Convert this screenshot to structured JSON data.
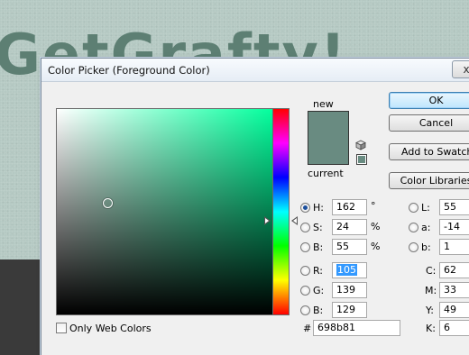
{
  "background": {
    "headline_text": "GetGrafty!",
    "colors": {
      "canvas": "#b5c9c3",
      "headline": "#5d7f73",
      "lower_band": "#3a3a3a"
    }
  },
  "dialog": {
    "title": "Color Picker (Foreground Color)",
    "close_glyph": "x",
    "swatch": {
      "new_label": "new",
      "current_label": "current",
      "new_color": "#698b81",
      "current_color": "#698b81"
    },
    "buttons": {
      "ok": "OK",
      "cancel": "Cancel",
      "add_to_swatches": "Add to Swatches",
      "color_libraries": "Color Libraries"
    },
    "icons": {
      "gamut_warning": "cube-icon",
      "websafe_warning": "websafe-swatch-icon"
    },
    "hsb": {
      "h": {
        "label": "H:",
        "value": "162",
        "unit": "°",
        "selected": true
      },
      "s": {
        "label": "S:",
        "value": "24",
        "unit": "%",
        "selected": false
      },
      "b": {
        "label": "B:",
        "value": "55",
        "unit": "%",
        "selected": false
      }
    },
    "rgb": {
      "r": {
        "label": "R:",
        "value": "105"
      },
      "g": {
        "label": "G:",
        "value": "139"
      },
      "b": {
        "label": "B:",
        "value": "129"
      }
    },
    "lab": {
      "l": {
        "label": "L:",
        "value": "55"
      },
      "a": {
        "label": "a:",
        "value": "-14"
      },
      "b": {
        "label": "b:",
        "value": "1"
      }
    },
    "cmyk": {
      "c": {
        "label": "C:",
        "value": "62"
      },
      "m": {
        "label": "M:",
        "value": "33"
      },
      "y": {
        "label": "Y:",
        "value": "49"
      },
      "k": {
        "label": "K:",
        "value": "6"
      }
    },
    "hex": {
      "label": "#",
      "value": "698b81"
    },
    "only_web_colors": {
      "label": "Only Web Colors",
      "checked": false
    },
    "picker": {
      "hue_pure_color": "#00ff9c",
      "hue_level_fraction": 0.45,
      "saturation_fraction": 0.24,
      "brightness_fraction": 0.55
    }
  }
}
